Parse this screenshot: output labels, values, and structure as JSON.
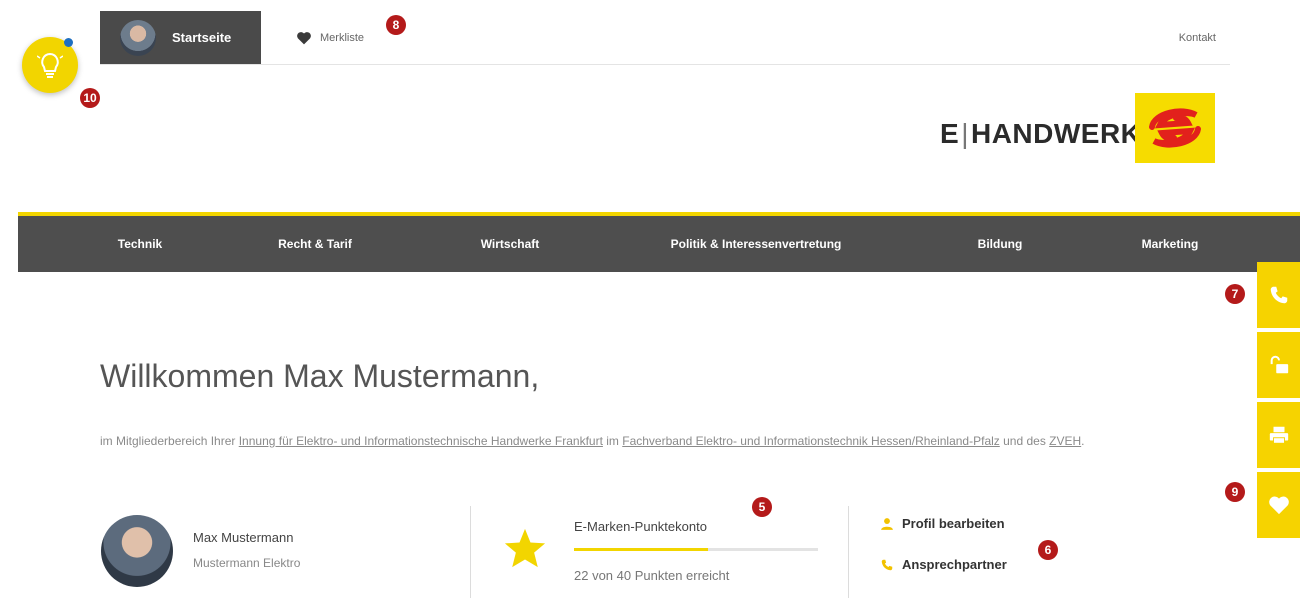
{
  "topbar": {
    "home_label": "Startseite",
    "watchlist_label": "Merkliste",
    "contact_label": "Kontakt"
  },
  "callouts": {
    "c5": "5",
    "c6": "6",
    "c7": "7",
    "c8": "8",
    "c9": "9",
    "c10": "10"
  },
  "logo": {
    "part1": "E",
    "separator": "|",
    "part2": "HANDWERK"
  },
  "nav": {
    "items": [
      "Technik",
      "Recht & Tarif",
      "Wirtschaft",
      "Politik & Interessenvertretung",
      "Bildung",
      "Marketing"
    ]
  },
  "side_actions": {
    "icons": [
      "phone-icon",
      "unlock-icon",
      "printer-icon",
      "heart-icon"
    ]
  },
  "welcome": {
    "heading": "Willkommen Max Mustermann,",
    "intro_1": "im Mitgliederbereich Ihrer ",
    "link_1": "Innung für Elektro- und Informationstechnische Handwerke Frankfurt",
    "intro_2": " im ",
    "link_2": "Fachverband Elektro- und Informationstechnik Hessen/Rheinland-Pfalz",
    "intro_3": " und des ",
    "link_3": "ZVEH",
    "intro_4": "."
  },
  "profile": {
    "name": "Max Mustermann",
    "company": "Mustermann Elektro"
  },
  "points": {
    "title": "E-Marken-Punktekonto",
    "status_text": "22 von 40 Punkten erreicht",
    "current": 22,
    "max": 40
  },
  "links": {
    "edit_profile": "Profil bearbeiten",
    "contact_person": "Ansprechpartner"
  },
  "colors": {
    "accent_yellow": "#f2d500",
    "nav_bg": "#4e4e4e",
    "callout_red": "#b41a1a"
  }
}
